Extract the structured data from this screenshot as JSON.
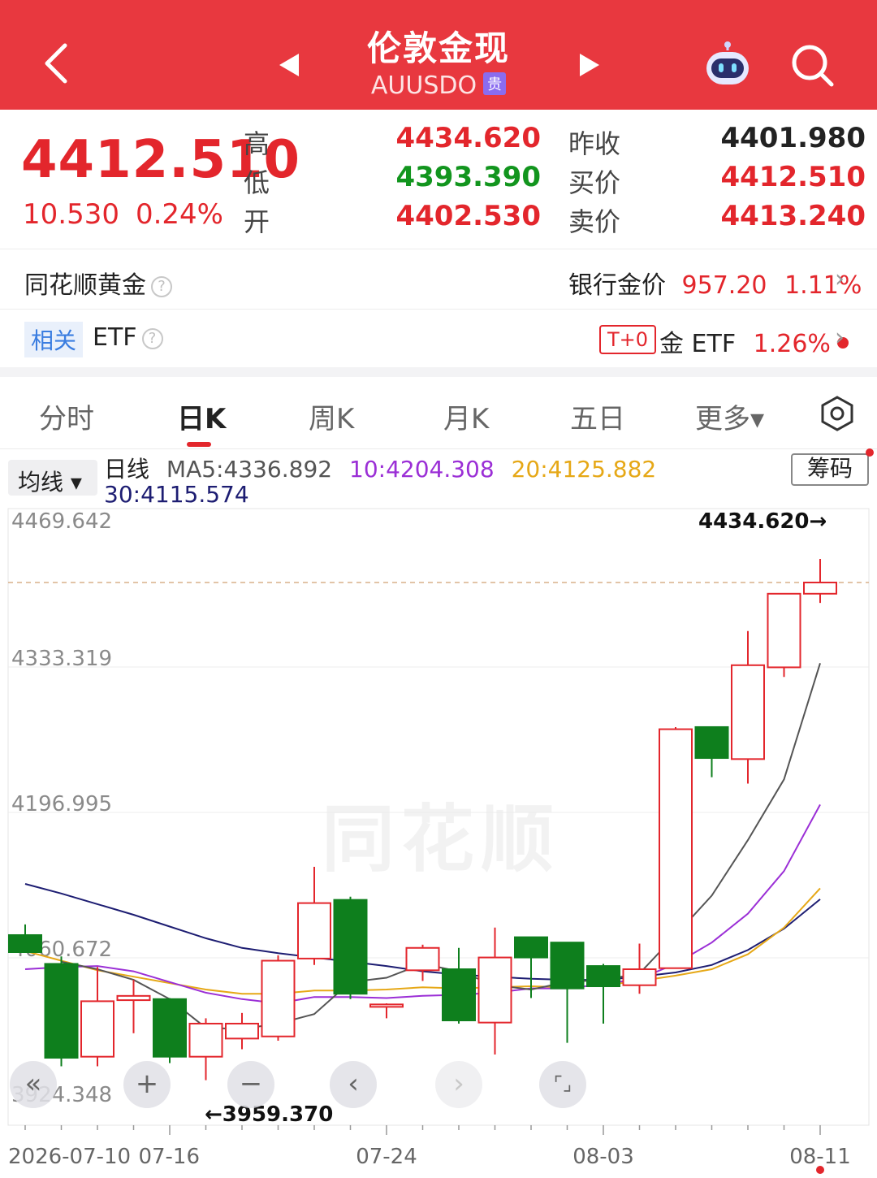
{
  "header": {
    "title": "伦敦金现",
    "code": "AUUSDO",
    "badge": "贵"
  },
  "quote": {
    "last_price": "4412.510",
    "change": "10.530",
    "change_pct": "0.24%",
    "high_label": "高",
    "high": "4434.620",
    "low_label": "低",
    "low": "4393.390",
    "open_label": "开",
    "open": "4402.530",
    "prev_close_label": "昨收",
    "prev_close": "4401.980",
    "bid_label": "买价",
    "bid": "4412.510",
    "ask_label": "卖价",
    "ask": "4413.240"
  },
  "gold_row": {
    "label": "同花顺黄金",
    "help": "?",
    "bank_label": "银行金价",
    "bank_price": "957.20",
    "bank_pct": "1.11%"
  },
  "etf_row": {
    "related": "相关",
    "label": "ETF",
    "help": "?",
    "t0": "T+0",
    "gold_etf": "金 ETF",
    "gold_etf_pct": "1.26%"
  },
  "tabs": [
    "分时",
    "日K",
    "周K",
    "月K",
    "五日",
    "更多▾"
  ],
  "active_tab": 1,
  "legend": {
    "ma_button": "均线 ▾",
    "period": "日线",
    "ma5": "MA5:4336.892",
    "ma10": "10:4204.308",
    "ma20": "20:4125.882",
    "ma30": "30:4115.574",
    "chip_button": "筹码"
  },
  "colors": {
    "brand_red": "#e8383f",
    "up": "#e3262c",
    "down": "#0e7f1d",
    "ma5": "#555555",
    "ma10": "#9b2fd6",
    "ma20": "#e6a817",
    "ma30": "#1d1d72"
  },
  "icons": {
    "back": "chevron-left-icon",
    "prev": "triangle-left-icon",
    "next": "triangle-right-icon",
    "assistant": "robot-icon",
    "search": "search-icon",
    "settings": "hexagon-settings-icon"
  },
  "watermark": "同花顺",
  "controls": [
    "«",
    "+",
    "−",
    "‹",
    "›",
    "⌜⌟"
  ],
  "chart_data": {
    "type": "candlestick",
    "y_ticks": [
      "4469.642",
      "4333.319",
      "4196.995",
      "4060.672",
      "3924.348"
    ],
    "ylim": [
      3924.348,
      4469.642
    ],
    "x_tick_labels": [
      "2026-07-10",
      "07-16",
      "07-24",
      "08-03",
      "08-11"
    ],
    "max_marker": "4434.620→",
    "min_marker": "←3959.370",
    "dashed_line_value": 4412.51,
    "candles": [
      {
        "o": 4082,
        "c": 4066,
        "h": 4092,
        "l": 4066
      },
      {
        "o": 4055,
        "c": 3967,
        "h": 4062,
        "l": 3959
      },
      {
        "o": 3968,
        "c": 4020,
        "h": 4052,
        "l": 3959
      },
      {
        "o": 4021,
        "c": 4025,
        "h": 4040,
        "l": 3990
      },
      {
        "o": 4022,
        "c": 3968,
        "h": 4023,
        "l": 3962
      },
      {
        "o": 3968,
        "c": 3999,
        "h": 4004,
        "l": 3946
      },
      {
        "o": 3985,
        "c": 3999,
        "h": 4009,
        "l": 3975
      },
      {
        "o": 3987,
        "c": 4058,
        "h": 4063,
        "l": 3983
      },
      {
        "o": 4060,
        "c": 4112,
        "h": 4146,
        "l": 4054
      },
      {
        "o": 4115,
        "c": 4027,
        "h": 4118,
        "l": 4022
      },
      {
        "o": 4016,
        "c": 4017,
        "h": 4018,
        "l": 4004
      },
      {
        "o": 4049,
        "c": 4070,
        "h": 4073,
        "l": 4039
      },
      {
        "o": 4050,
        "c": 4002,
        "h": 4070,
        "l": 3999
      },
      {
        "o": 4000,
        "c": 4061,
        "h": 4089,
        "l": 3970
      },
      {
        "o": 4080,
        "c": 4061,
        "h": 4079,
        "l": 4023
      },
      {
        "o": 4075,
        "c": 4032,
        "h": 4075,
        "l": 3981
      },
      {
        "o": 4053,
        "c": 4034,
        "h": 4055,
        "l": 3999
      },
      {
        "o": 4035,
        "c": 4050,
        "h": 4074,
        "l": 4027
      },
      {
        "o": 4051,
        "c": 4275,
        "h": 4277,
        "l": 4051
      },
      {
        "o": 4277,
        "c": 4248,
        "h": 4271,
        "l": 4230
      },
      {
        "o": 4247,
        "c": 4335,
        "h": 4367,
        "l": 4224
      },
      {
        "o": 4333,
        "c": 4402,
        "h": 4402,
        "l": 4324
      },
      {
        "o": 4402,
        "c": 4412.51,
        "h": 4434.62,
        "l": 4393.39
      }
    ],
    "ma5": [
      null,
      4057,
      4050,
      4040,
      4022,
      3995,
      3994,
      3999,
      4008,
      4038,
      4042,
      4055,
      4048,
      4035,
      4031,
      4038,
      4040,
      4046,
      4082,
      4119,
      4171,
      4228,
      4336.892
    ],
    "ma10": [
      4050,
      4052,
      4053,
      4048,
      4038,
      4028,
      4022,
      4018,
      4024,
      4024,
      4023,
      4025,
      4026,
      4028,
      4032,
      4032,
      4036,
      4041,
      4055,
      4075,
      4102,
      4142,
      4204.308
    ],
    "ma20": [
      4067,
      4058,
      4049,
      4043,
      4037,
      4031,
      4027,
      4027,
      4030,
      4030,
      4031,
      4033,
      4032,
      4033,
      4034,
      4033,
      4035,
      4039,
      4044,
      4050,
      4064,
      4089,
      4125.882
    ],
    "ma30": [
      4130,
      4121,
      4111,
      4101,
      4090,
      4079,
      4070,
      4065,
      4061,
      4057,
      4053,
      4048,
      4045,
      4043,
      4041,
      4040,
      4040,
      4043,
      4047,
      4054,
      4068,
      4088,
      4115.574
    ]
  }
}
